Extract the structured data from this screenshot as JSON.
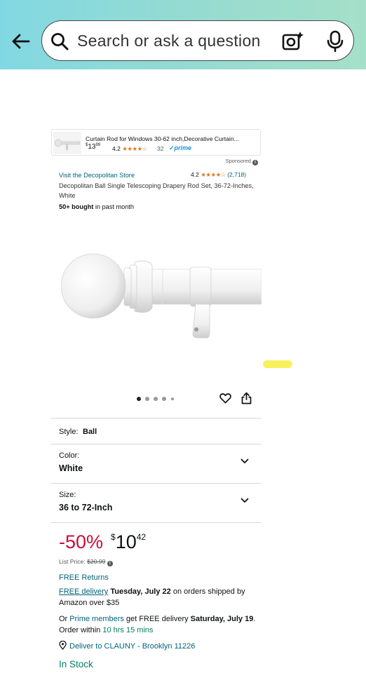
{
  "search": {
    "placeholder": "Search or ask a question"
  },
  "icons": {
    "back": "back-arrow-icon",
    "search": "search-icon",
    "camera": "camera-icon",
    "mic": "microphone-icon"
  },
  "sponsored_ad": {
    "title": "Curtain Rod for Windows 30-62 inch,Decorative Curtain...",
    "price_whole": "13",
    "price_fraction": "99",
    "price_symbol": "$",
    "rating": "4.2",
    "stars": "★★★★☆",
    "count": "32",
    "prime": "prime",
    "label": "Sponsored"
  },
  "product": {
    "store": "Visit the Decopolitan Store",
    "rating": "4.2",
    "stars": "★★★★☆",
    "rating_count": "(2,718)",
    "title": "Decopolitan Ball Single Telescoping Drapery Rod Set, 36-72-Inches, White",
    "bought_bold": "50+ bought",
    "bought_rest": " in past month"
  },
  "options": {
    "style_label": "Style:",
    "style_value": "Ball",
    "color_label": "Color:",
    "color_value": "White",
    "size_label": "Size:",
    "size_value": "36 to 72-Inch"
  },
  "pricing": {
    "discount": "-50%",
    "currency": "$",
    "whole": "10",
    "fraction": "42",
    "list_label": "List Price: ",
    "list_price": "$20.99"
  },
  "delivery": {
    "returns": "FREE Returns",
    "free_delivery": "FREE delivery",
    "date": "Tuesday, July 22",
    "tail": " on orders shipped by Amazon over $35",
    "prime_or": "Or ",
    "prime_members": "Prime members",
    "prime_mid": " get FREE delivery ",
    "prime_date": "Saturday, July 19",
    "order_within": ". Order within ",
    "countdown": "10 hrs 15 mins",
    "deliver_to": "Deliver to CLAUNY - Brooklyn 11226",
    "stock": "In Stock"
  },
  "colors": {
    "accent_red": "#cc0c39",
    "link": "#00627a",
    "stock_green": "#067d62",
    "star": "#de7921"
  }
}
